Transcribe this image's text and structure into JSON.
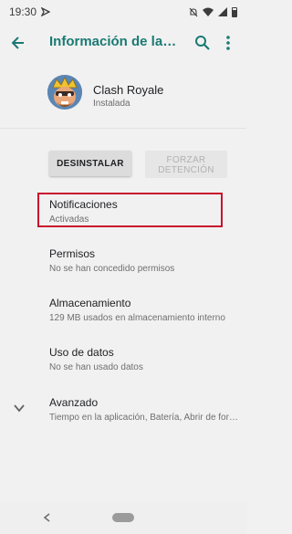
{
  "status_bar": {
    "time": "19:30"
  },
  "toolbar": {
    "title": "Información de la aplicación"
  },
  "app": {
    "name": "Clash Royale",
    "status": "Instalada"
  },
  "buttons": {
    "uninstall": "DESINSTALAR",
    "force_stop_line1": "FORZAR",
    "force_stop_line2": "DETENCIÓN"
  },
  "settings": [
    {
      "title": "Notificaciones",
      "subtitle": "Activadas"
    },
    {
      "title": "Permisos",
      "subtitle": "No se han concedido permisos"
    },
    {
      "title": "Almacenamiento",
      "subtitle": "129 MB usados en almacenamiento interno"
    },
    {
      "title": "Uso de datos",
      "subtitle": "No se han usado datos"
    },
    {
      "title": "Avanzado",
      "subtitle": "Tiempo en la aplicación, Batería, Abrir de forma predeterminada"
    }
  ],
  "colors": {
    "accent": "#1a7a73",
    "highlight": "#c8102e"
  }
}
